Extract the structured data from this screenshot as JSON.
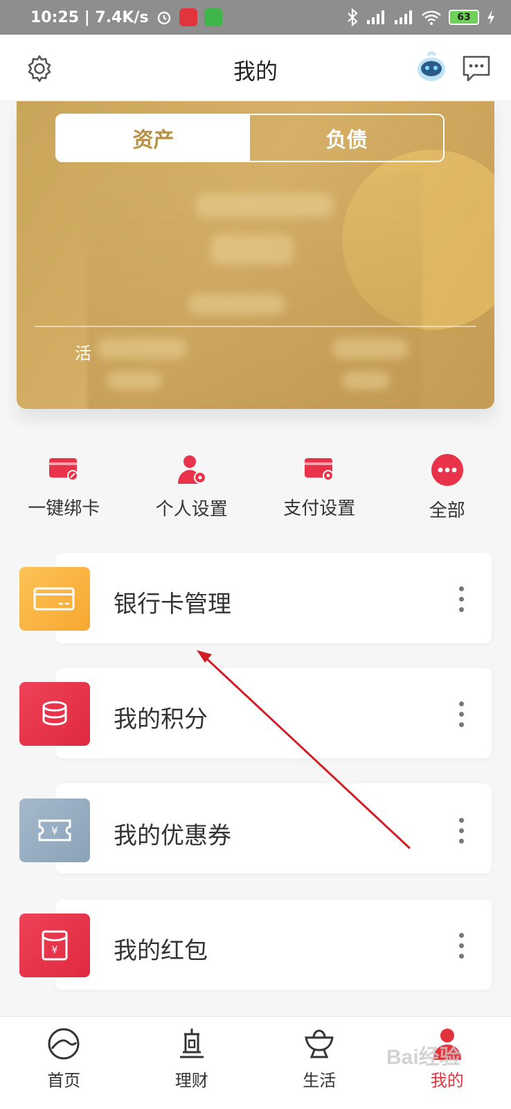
{
  "status_bar": {
    "time": "10:25 | 7.4K/s",
    "battery": "63"
  },
  "header": {
    "title": "我的"
  },
  "card": {
    "tabs": [
      {
        "label": "资产",
        "active": true
      },
      {
        "label": "负债",
        "active": false
      }
    ],
    "bottom_label": "活"
  },
  "quick_actions": [
    {
      "label": "一键绑卡",
      "icon": "card-link-icon"
    },
    {
      "label": "个人设置",
      "icon": "person-settings-icon"
    },
    {
      "label": "支付设置",
      "icon": "payment-settings-icon"
    },
    {
      "label": "全部",
      "icon": "more-icon"
    }
  ],
  "menu_items": [
    {
      "label": "银行卡管理",
      "icon": "bank-card-icon",
      "color": "#fbb245"
    },
    {
      "label": "我的积分",
      "icon": "points-coins-icon",
      "color": "#e8334a"
    },
    {
      "label": "我的优惠券",
      "icon": "coupon-icon",
      "color": "#93a9bd"
    },
    {
      "label": "我的红包",
      "icon": "red-envelope-icon",
      "color": "#e8334a"
    }
  ],
  "tabbar": [
    {
      "label": "首页",
      "icon": "home-icon",
      "active": false
    },
    {
      "label": "理财",
      "icon": "finance-icon",
      "active": false
    },
    {
      "label": "生活",
      "icon": "life-icon",
      "active": false
    },
    {
      "label": "我的",
      "icon": "profile-icon",
      "active": true
    }
  ],
  "colors": {
    "accent": "#e2343c",
    "gold": "#c9a55a"
  },
  "watermark": "Bai经验"
}
